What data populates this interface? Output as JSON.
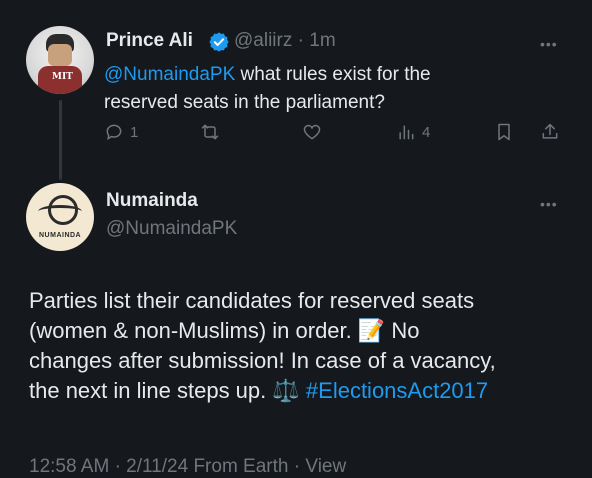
{
  "tweet1": {
    "name": "Prince Ali",
    "handle": "@aliirz",
    "time": "1m",
    "separator": "·",
    "mention": "@NumaindaPK",
    "text_line1_rest": " what rules exist for the",
    "text_line2": "reserved seats in the parliament?",
    "avatar_text": "MIT",
    "stats": {
      "replies": "1",
      "views": "4"
    }
  },
  "tweet2": {
    "name": "Numainda",
    "handle": "@NumaindaPK",
    "avatar_text": "NUMAINDA",
    "line1": "Parties list their candidates for reserved seats",
    "line2_part1": "(women & non-Muslims) in order. ",
    "line2_emoji": "📝",
    "line2_part2": " No",
    "line3": "changes after submission! In case of a vacancy,",
    "line4_part1": "the next in line steps up. ",
    "line4_emoji": "⚖️",
    "hashtag": "#ElectionsAct2017"
  },
  "footer": {
    "time": "12:58 AM",
    "separator": "·",
    "date": "2/11/24",
    "from": "From Earth",
    "view": "View"
  },
  "icons": {
    "more": "more-icon",
    "verified": "verified-badge-icon",
    "reply": "reply-icon",
    "retweet": "retweet-icon",
    "like": "like-icon",
    "views": "views-icon",
    "bookmark": "bookmark-icon",
    "share": "share-icon"
  },
  "colors": {
    "background": "#15181c",
    "text": "#e7e9ea",
    "muted": "#71767b",
    "accent": "#1d9bf0"
  }
}
